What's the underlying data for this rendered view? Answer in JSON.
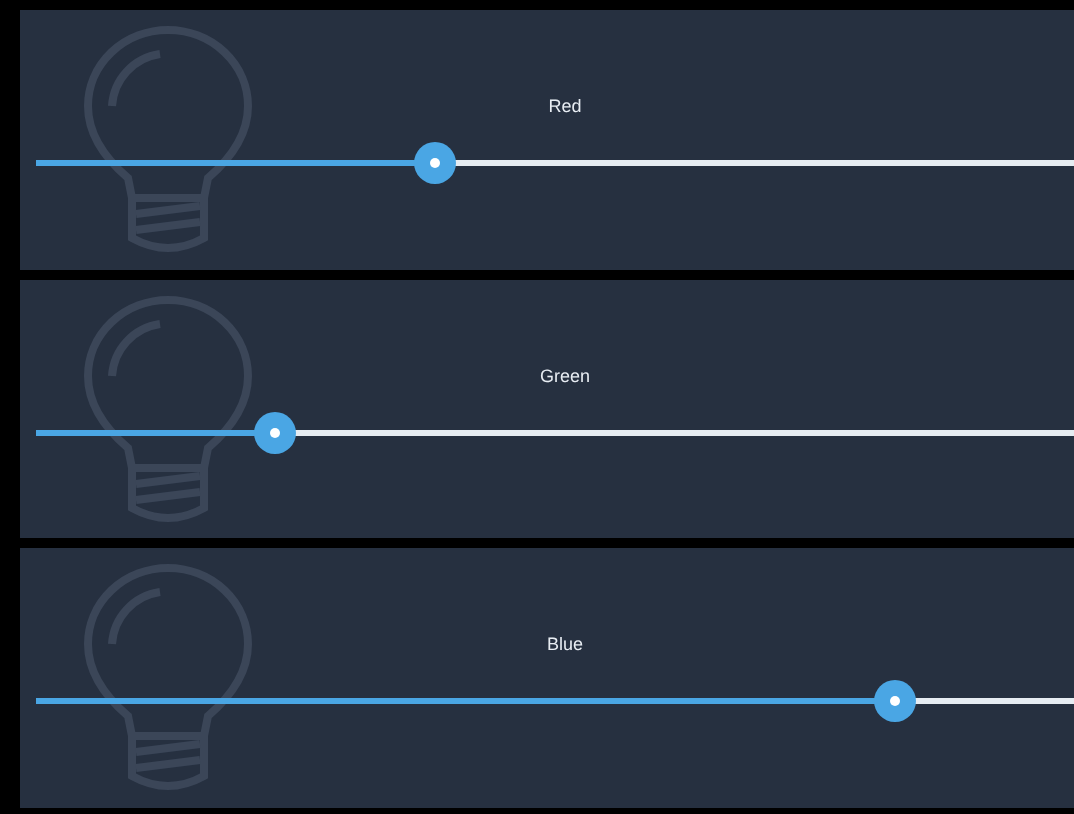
{
  "sliders": [
    {
      "label": "Red",
      "level": 0.385
    },
    {
      "label": "Green",
      "level": 0.23
    },
    {
      "label": "Blue",
      "level": 0.827
    }
  ]
}
